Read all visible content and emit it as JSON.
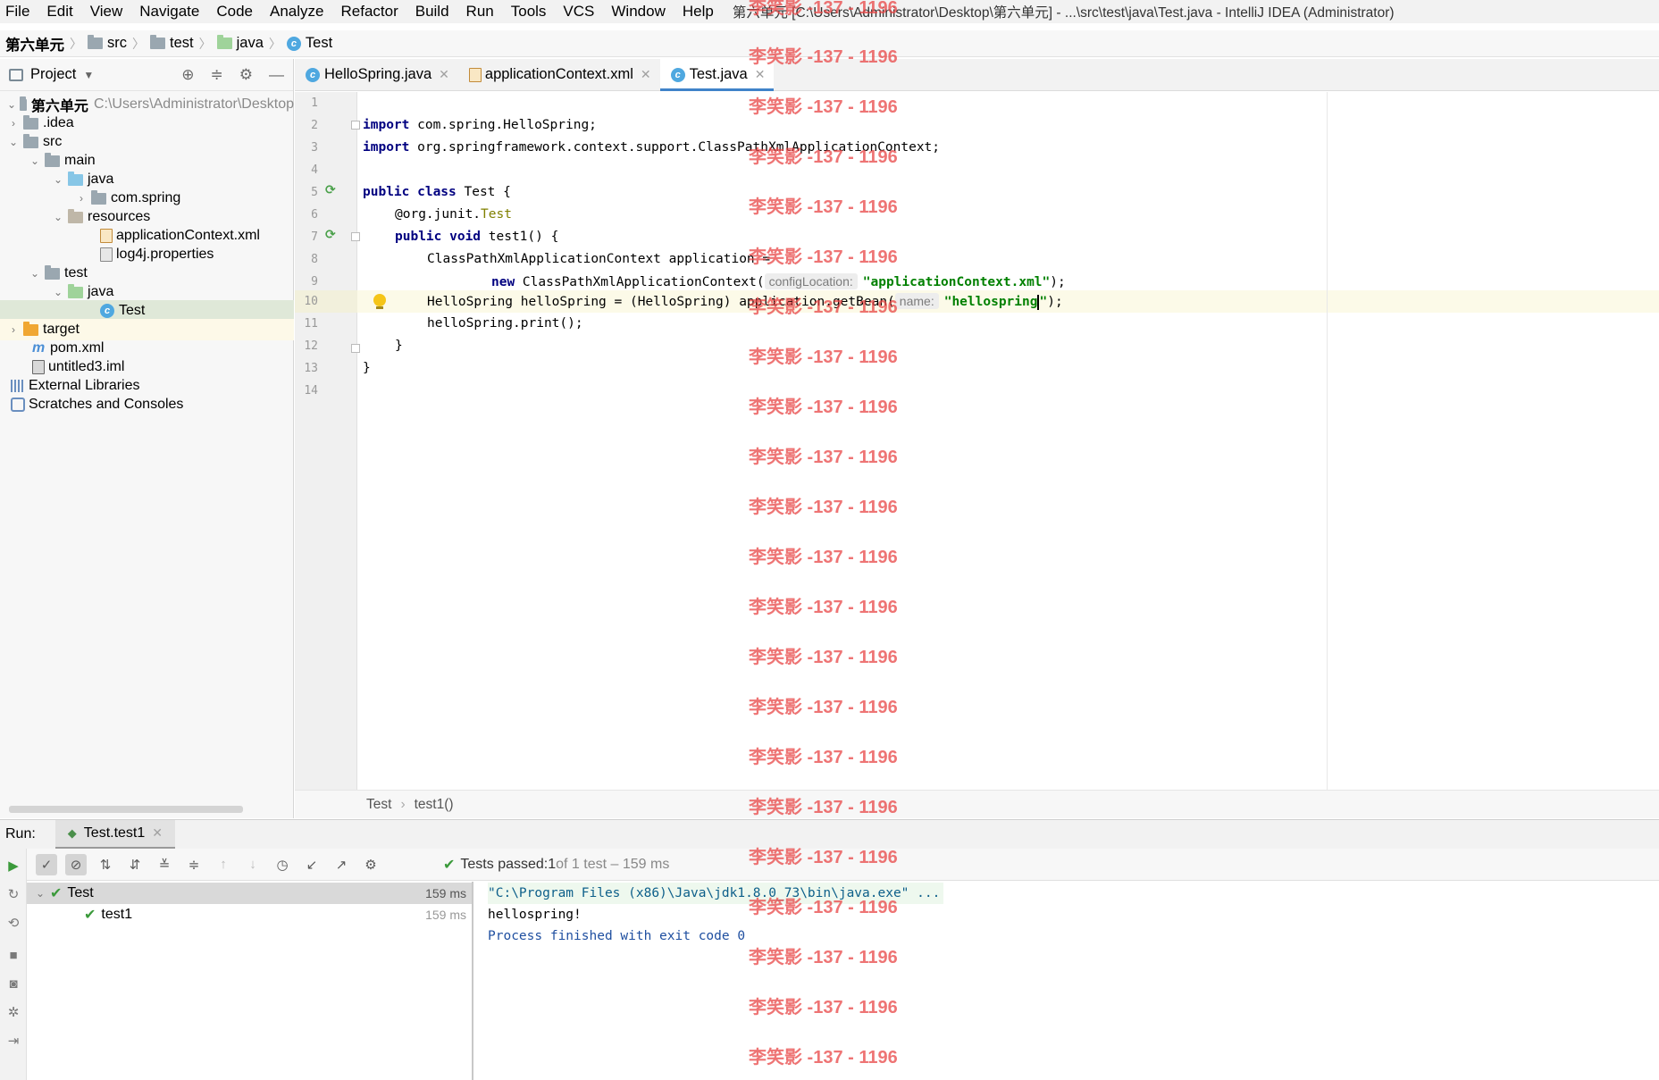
{
  "menu": {
    "items": [
      "File",
      "Edit",
      "View",
      "Navigate",
      "Code",
      "Analyze",
      "Refactor",
      "Build",
      "Run",
      "Tools",
      "VCS",
      "Window",
      "Help"
    ],
    "window_title": "第六单元 [C:\\Users\\Administrator\\Desktop\\第六单元] - ...\\src\\test\\java\\Test.java - IntelliJ IDEA (Administrator)"
  },
  "breadcrumb": [
    "第六单元",
    "src",
    "test",
    "java",
    "Test"
  ],
  "project": {
    "title": "Project",
    "root_name": "第六单元",
    "root_path": "C:\\Users\\Administrator\\Desktop",
    "tree": [
      ".idea",
      "src",
      "main",
      "java",
      "com.spring",
      "resources",
      "applicationContext.xml",
      "log4j.properties",
      "test",
      "java",
      "Test",
      "target",
      "pom.xml",
      "untitled3.iml",
      "External Libraries",
      "Scratches and Consoles"
    ]
  },
  "tabs": [
    "HelloSpring.java",
    "applicationContext.xml",
    "Test.java"
  ],
  "editor": {
    "line_numbers": [
      "1",
      "2",
      "3",
      "4",
      "5",
      "6",
      "7",
      "8",
      "9",
      "10",
      "11",
      "12",
      "13",
      "14"
    ],
    "code": {
      "l2_kw": "import",
      "l2_rest": " com.spring.HelloSpring;",
      "l3_kw": "import",
      "l3_rest": " org.springframework.context.support.ClassPathXmlApplicationContext;",
      "l5_kw": "public class",
      "l5_rest": " Test {",
      "l6_at": "@org.junit.",
      "l6_ann": "Test",
      "l7_kw": "public void",
      "l7_rest": " test1() {",
      "l8": "ClassPathXmlApplicationContext application =",
      "l9_kw": "new",
      "l9_rest": " ClassPathXmlApplicationContext(",
      "l9_hint": "configLocation:",
      "l9_str": "\"applicationContext.xml\"",
      "l9_end": ");",
      "l10_pre": "HelloSpring helloSpring = (HelloSpring) application.getBean(",
      "l10_hint": "name:",
      "l10_str_a": "\"hellospring",
      "l10_str_b": "\"",
      "l10_end": ");",
      "l11": "helloSpring.print();",
      "l12": "}",
      "l13": "}"
    }
  },
  "editor_breadcrumb": [
    "Test",
    "test1()"
  ],
  "run": {
    "label": "Run:",
    "tab": "Test.test1",
    "status_main": "Tests passed:",
    "status_count": " 1",
    "status_rest": " of 1 test – 159 ms",
    "tree": [
      {
        "name": "Test",
        "time": "159 ms"
      },
      {
        "name": "test1",
        "time": "159 ms"
      }
    ],
    "console": [
      "\"C:\\Program Files (x86)\\Java\\jdk1.8.0_73\\bin\\java.exe\" ...",
      "hellospring!",
      "Process finished with exit code 0"
    ]
  },
  "watermark": "李笑影 -137 - 1196"
}
